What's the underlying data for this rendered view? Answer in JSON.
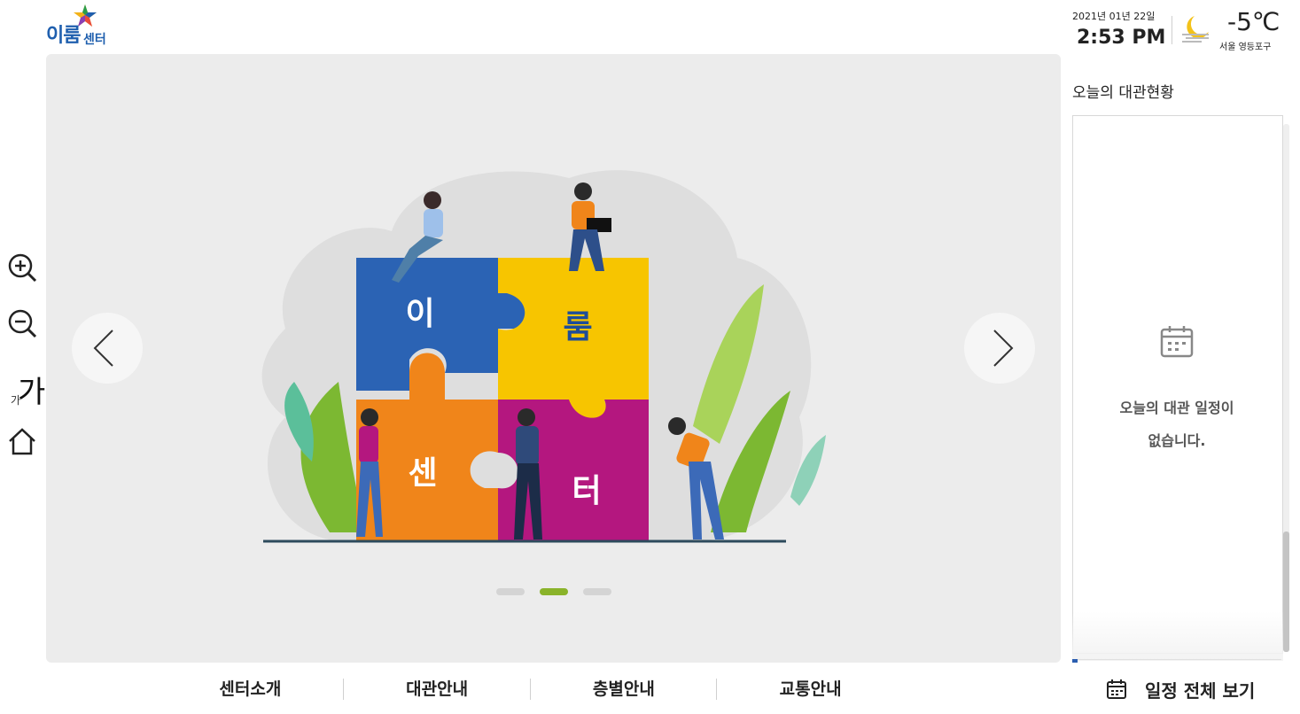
{
  "header": {
    "logo_text_main": "이룸",
    "logo_text_sub": "센터",
    "date": "2021년 01년 22일",
    "time": "2:53 PM",
    "temperature": "-5℃",
    "location": "서울 영등포구",
    "weather_icon": "moon-fog-icon"
  },
  "slider": {
    "slide_labels": [
      "이",
      "룸",
      "센",
      "터"
    ],
    "dots": [
      "slide-1",
      "slide-2",
      "slide-3"
    ],
    "active_dot": 1,
    "colors": {
      "blue": "#2b63b4",
      "yellow": "#f7c500",
      "orange": "#f0851a",
      "magenta": "#b4177f",
      "green": "#8ab32a"
    }
  },
  "tools": {
    "zoom_in_icon": "zoom-in-icon",
    "zoom_out_icon": "zoom-out-icon",
    "font_small": "가",
    "font_big": "가",
    "home_icon": "home-icon"
  },
  "panel": {
    "title": "오늘의 대관현황",
    "empty_line1": "오늘의 대관 일정이",
    "empty_line2": "없습니다."
  },
  "nav": {
    "items": [
      "센터소개",
      "대관안내",
      "층별안내",
      "교통안내"
    ],
    "view_all": "일정 전체 보기"
  }
}
